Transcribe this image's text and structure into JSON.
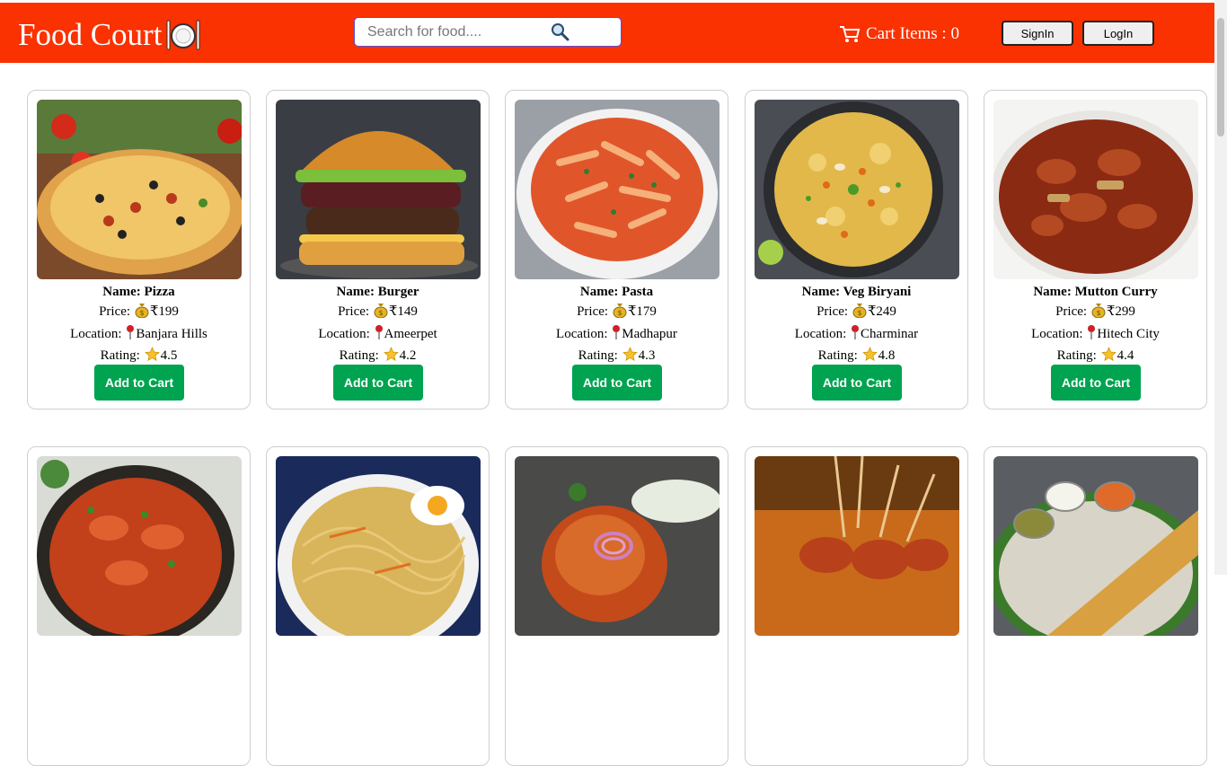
{
  "header": {
    "brand": "Food Court",
    "brand_icon": "plate-fork-knife-icon",
    "search_placeholder": "Search for food....",
    "search_icon": "magnifier-icon",
    "cart_label": "Cart Items : 0",
    "cart_icon": "shopping-cart-icon",
    "signin_label": "SignIn",
    "login_label": "LogIn",
    "bg_color": "#fa3100"
  },
  "labels": {
    "name": "Name: ",
    "price": "Price: ",
    "location": "Location: ",
    "rating": "Rating: ",
    "add_to_cart": "Add to Cart"
  },
  "items": [
    {
      "name": "Pizza",
      "price": "₹199",
      "location": "Banjara Hills",
      "rating": "4.5"
    },
    {
      "name": "Burger",
      "price": "₹149",
      "location": "Ameerpet",
      "rating": "4.2"
    },
    {
      "name": "Pasta",
      "price": "₹179",
      "location": "Madhapur",
      "rating": "4.3"
    },
    {
      "name": "Veg Biryani",
      "price": "₹249",
      "location": "Charminar",
      "rating": "4.8"
    },
    {
      "name": "Mutton Curry",
      "price": "₹299",
      "location": "Hitech City",
      "rating": "4.4"
    }
  ],
  "second_row_images": [
    "chicken-curry",
    "noodles",
    "tandoori-chicken",
    "chicken-skewers",
    "masala-dosa"
  ],
  "colors": {
    "add_button": "#00a34f",
    "card_border": "#cfcfcf"
  }
}
